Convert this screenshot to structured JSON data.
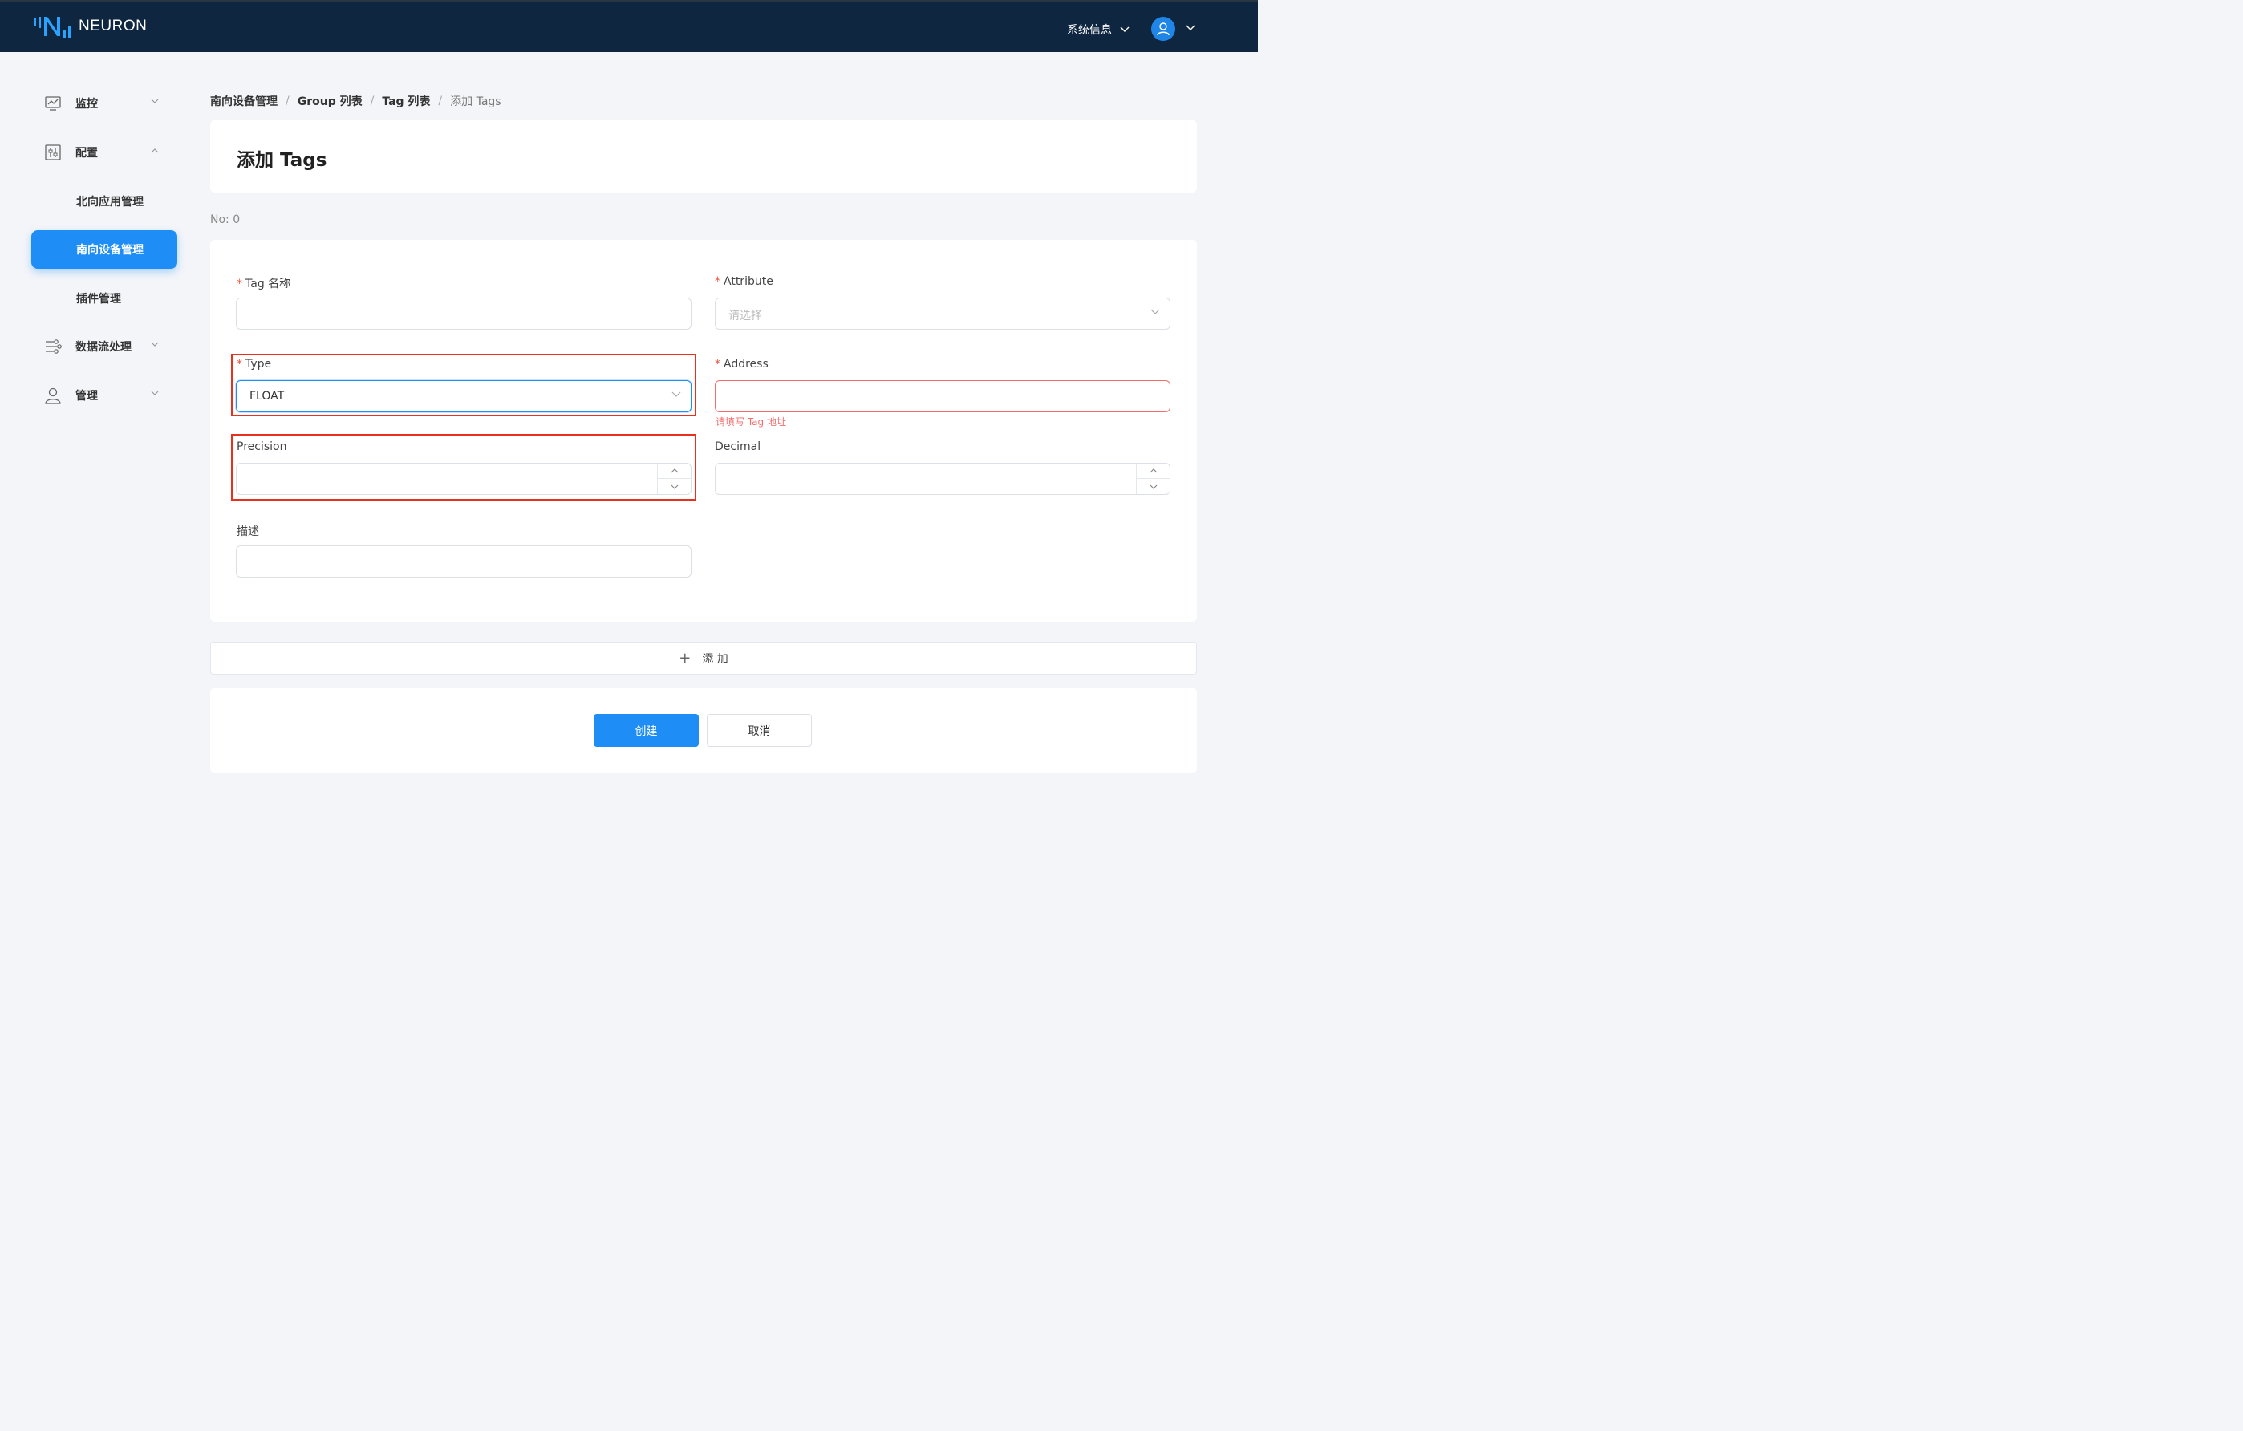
{
  "app": {
    "name": "NEURON"
  },
  "header": {
    "sysinfo_label": "系统信息"
  },
  "sidebar": {
    "items": [
      {
        "label": "监控",
        "icon": "monitor-chart-icon"
      },
      {
        "label": "配置",
        "icon": "config-sliders-icon"
      },
      {
        "label": "北向应用管理"
      },
      {
        "label": "南向设备管理",
        "active": true
      },
      {
        "label": "插件管理"
      },
      {
        "label": "数据流处理",
        "icon": "data-flow-icon"
      },
      {
        "label": "管理",
        "icon": "user-icon"
      }
    ]
  },
  "breadcrumb": [
    "南向设备管理",
    "Group 列表",
    "Tag 列表",
    "添加 Tags"
  ],
  "page": {
    "title": "添加 Tags",
    "no_label": "No: 0"
  },
  "form": {
    "tag_name": {
      "label": "Tag 名称",
      "required": "*",
      "value": ""
    },
    "attribute": {
      "label": "Attribute",
      "required": "*",
      "placeholder": "请选择"
    },
    "type": {
      "label": "Type",
      "required": "*",
      "value": "FLOAT"
    },
    "address": {
      "label": "Address",
      "required": "*",
      "value": "",
      "error": "请填写 Tag 地址"
    },
    "precision": {
      "label": "Precision",
      "value": ""
    },
    "decimal": {
      "label": "Decimal",
      "value": ""
    },
    "description": {
      "label": "描述",
      "value": ""
    }
  },
  "add_button": {
    "icon": "+",
    "label": "添 加"
  },
  "actions": {
    "create": "创建",
    "cancel": "取消"
  },
  "colors": {
    "header_bg": "#0e2640",
    "accent": "#1e8ef6",
    "error": "#f56c6c",
    "highlight": "#e8301c"
  }
}
